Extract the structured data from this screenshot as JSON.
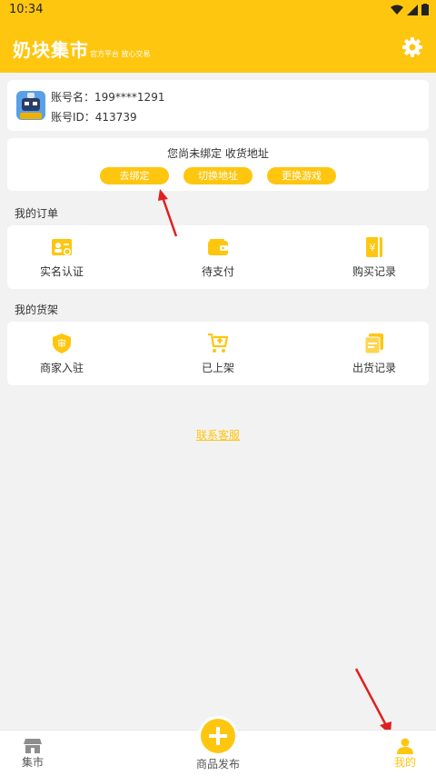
{
  "status_bar": {
    "time": "10:34"
  },
  "header": {
    "title": "奶块集市",
    "subtitle": "官方平台 放心交易"
  },
  "account": {
    "name_label": "账号名：",
    "name_value": "199****1291",
    "id_label": "账号ID：",
    "id_value": "413739"
  },
  "binding": {
    "message": "您尚未绑定 收货地址",
    "buttons": [
      "去绑定",
      "切换地址",
      "更换游戏"
    ]
  },
  "orders": {
    "title": "我的订单",
    "items": [
      {
        "label": "实名认证",
        "icon": "id-card-icon"
      },
      {
        "label": "待支付",
        "icon": "wallet-icon"
      },
      {
        "label": "购买记录",
        "icon": "purchase-record-icon"
      }
    ]
  },
  "shelf": {
    "title": "我的货架",
    "items": [
      {
        "label": "商家入驻",
        "icon": "merchant-shield-icon"
      },
      {
        "label": "已上架",
        "icon": "cart-icon"
      },
      {
        "label": "出货记录",
        "icon": "shipment-record-icon"
      }
    ]
  },
  "support_link": "联系客服",
  "tabs": [
    {
      "label": "集市",
      "icon": "market-icon"
    },
    {
      "label": "商品发布",
      "icon": "plus-icon"
    },
    {
      "label": "我的",
      "icon": "user-icon",
      "active": true
    }
  ],
  "colors": {
    "accent": "#ffc60f",
    "annotation": "#e02020"
  }
}
